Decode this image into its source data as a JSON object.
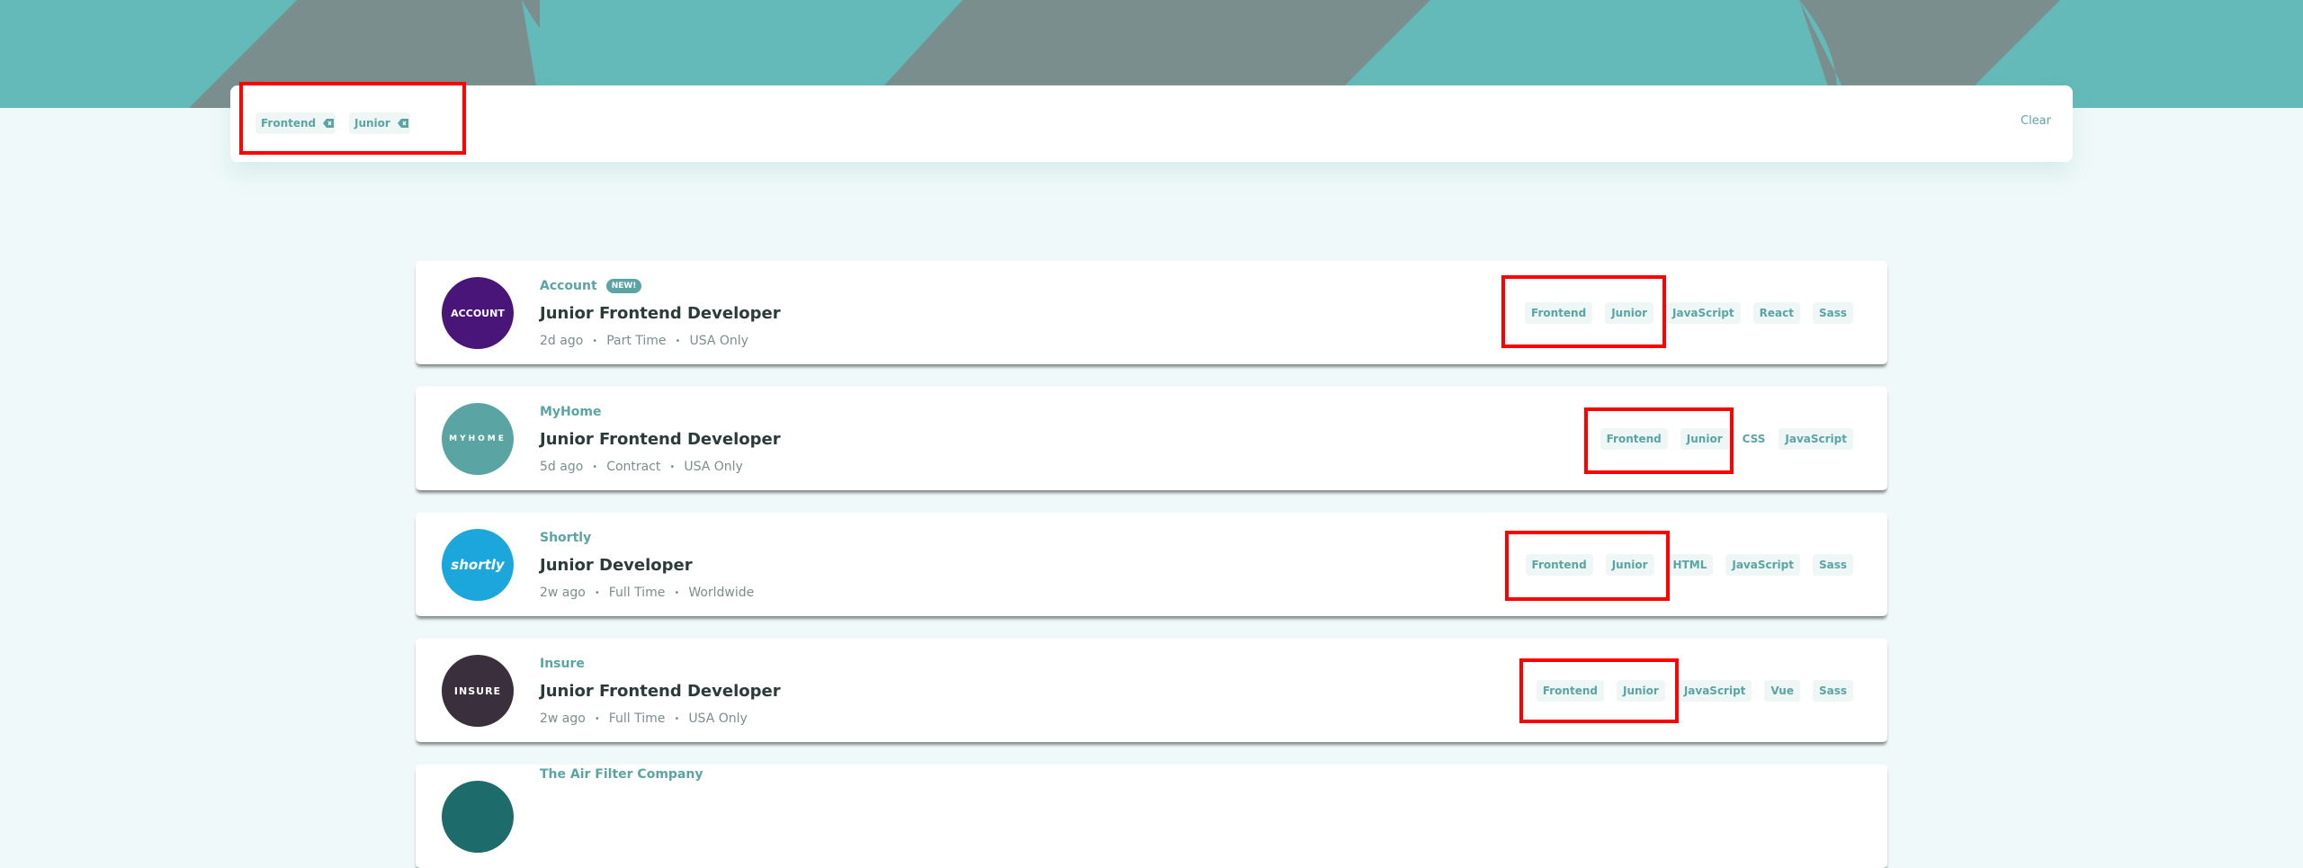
{
  "colors": {
    "accent": "#5ba4a4",
    "header_bg": "#63bab9",
    "header_shape": "#7b8e8e",
    "page_bg": "#eff9f9",
    "highlight": "#ff0000"
  },
  "filter_bar": {
    "chips": [
      {
        "label": "Frontend",
        "remove_icon": "remove-icon"
      },
      {
        "label": "Junior",
        "remove_icon": "remove-icon"
      }
    ],
    "clear_label": "Clear"
  },
  "jobs": [
    {
      "logo_text": "ACCOUNT",
      "logo_color": "#4a1578",
      "company": "Account",
      "badge": "NEW!",
      "position": "Junior Frontend Developer",
      "posted": "2d ago",
      "contract": "Part Time",
      "location": "USA Only",
      "tags": [
        "Frontend",
        "Junior",
        "JavaScript",
        "React",
        "Sass"
      ]
    },
    {
      "logo_text": "MYHOME",
      "logo_color": "#5ba4a4",
      "company": "MyHome",
      "position": "Junior Frontend Developer",
      "posted": "5d ago",
      "contract": "Contract",
      "location": "USA Only",
      "tags": [
        "Frontend",
        "Junior",
        "CSS",
        "JavaScript"
      ]
    },
    {
      "logo_text": "shortly",
      "logo_color": "#1ca7dc",
      "company": "Shortly",
      "position": "Junior Developer",
      "posted": "2w ago",
      "contract": "Full Time",
      "location": "Worldwide",
      "tags": [
        "Frontend",
        "Junior",
        "HTML",
        "JavaScript",
        "Sass"
      ]
    },
    {
      "logo_text": "INSURE",
      "logo_color": "#3a2f3c",
      "company": "Insure",
      "position": "Junior Frontend Developer",
      "posted": "2w ago",
      "contract": "Full Time",
      "location": "USA Only",
      "tags": [
        "Frontend",
        "Junior",
        "JavaScript",
        "Vue",
        "Sass"
      ]
    },
    {
      "logo_color": "#1d6b6b",
      "company": "The Air Filter Company"
    }
  ]
}
